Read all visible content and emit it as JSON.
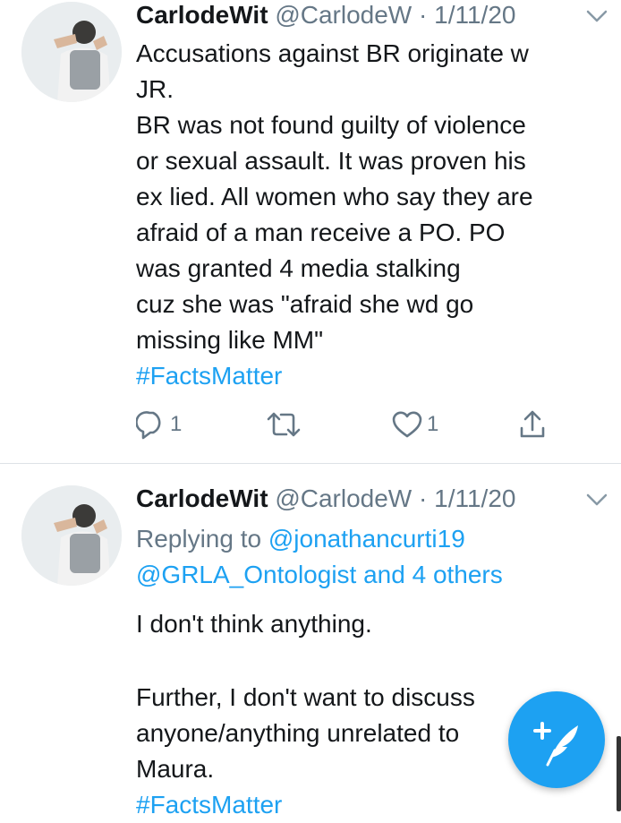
{
  "colors": {
    "accent": "#1da1f2",
    "meta_gray": "#657786",
    "text": "#14171a",
    "divider": "#dde2e6"
  },
  "tweets": [
    {
      "author_name": "CarlodeWit",
      "handle": "@CarlodeW",
      "separator": "·",
      "date": "1/11/20",
      "text": "Accusations against BR originate w\nJR.\nBR was not found guilty of violence\nor sexual assault.  It was proven his\nex lied.  All women who say they are\nafraid of a man receive a PO. PO\nwas granted 4 media stalking\ncuz she was \"afraid she wd go\nmissing like MM\"",
      "hashtag": "#FactsMatter",
      "actions": {
        "reply_icon": "reply-icon",
        "reply_count": "1",
        "retweet_icon": "retweet-icon",
        "like_icon": "heart-icon",
        "like_count": "1",
        "share_icon": "share-icon"
      }
    },
    {
      "author_name": "CarlodeWit",
      "handle": "@CarlodeW",
      "separator": "·",
      "date": "1/11/20",
      "replying_prefix": "Replying to",
      "replying_to_1": "@jonathancurti19",
      "replying_to_2": "@GRLA_Ontologist and 4 others",
      "paragraph_1": "I don't think anything.",
      "paragraph_2": "Further, I don't want to discuss\nanyone/anything unrelated to\nMaura.",
      "hashtag": "#FactsMatter"
    }
  ],
  "compose_button": {
    "icon": "compose-feather-icon"
  }
}
